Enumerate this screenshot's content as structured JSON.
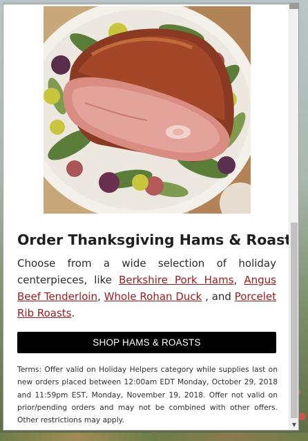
{
  "hero_image": {
    "alt": "Glazed holiday ham on a platter with figs and herbs",
    "icon": "ham-photo"
  },
  "offer": {
    "title": "Order Thanksgiving Hams & Roasts",
    "desc_intro": "Choose from a wide selection of holiday centerpieces, like ",
    "sep_1": ", ",
    "sep_2": ", ",
    "sep_3": " , and ",
    "desc_end": ".",
    "links": [
      "Berkshire Pork Hams",
      "Angus Beef Tenderloin",
      "Whole Rohan Duck",
      "Porcelet Rib Roasts"
    ],
    "cta_label": "SHOP HAMS & ROASTS",
    "terms": "Terms: Offer valid on Holiday Helpers category while supplies last on new orders placed between 12:00am EDT Monday, October 29, 2018 and 11:59pm EST, Monday, November 19, 2018. Offer not valid on prior/pending orders and may not be combined with other offers. Other restrictions may apply."
  },
  "scrollbar": {
    "down_arrow_icon": "chevron-down-icon"
  },
  "colors": {
    "link": "#9a1b1b",
    "button_bg": "#000000",
    "button_text": "#ffffff",
    "title": "#1e1e1e"
  }
}
